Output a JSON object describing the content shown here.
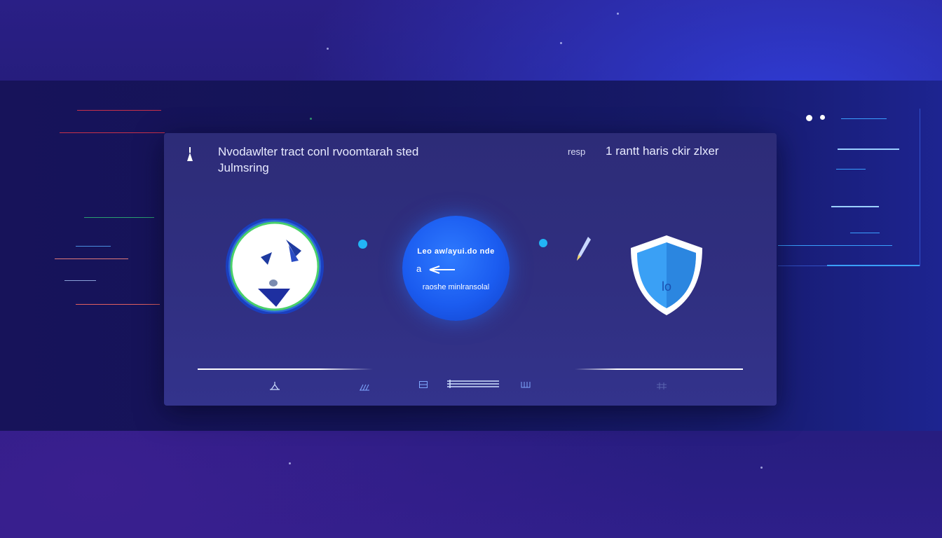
{
  "card": {
    "title_line1": "Nvodawlter tract conl rvoomtarah sted",
    "title_line2": "Julmsring",
    "header_right_small": "resp",
    "header_right_main": "1 rantt haris ckir zlxer"
  },
  "center_badge": {
    "line1": "Leo aw/ayui.do nde",
    "line2": "a",
    "line3": "raoshe minlransolal"
  },
  "shield": {
    "label": "lo"
  },
  "colors": {
    "accent": "#2f7bff",
    "dot": "#22b5f5",
    "shield": "#3aa0f5"
  }
}
